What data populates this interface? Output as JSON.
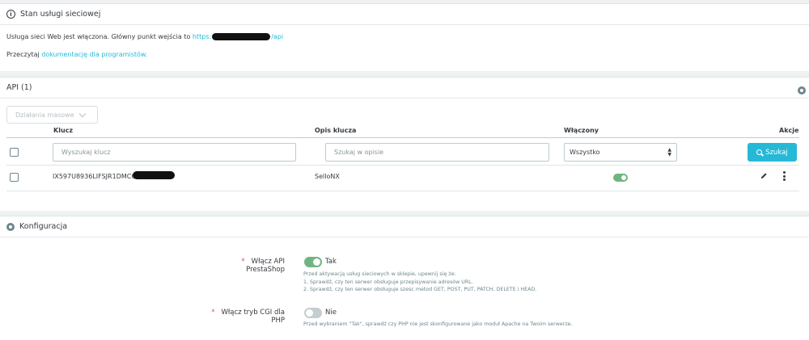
{
  "service_panel": {
    "title": "Stan usługi sieciowej",
    "status_text": "Usługa sieci Web jest włączona. Główny punkt wejścia to",
    "url_prefix": "https:",
    "url_suffix": "/api",
    "read_text": "Przeczytaj",
    "docs_link": "dokumentację dla programistów."
  },
  "api_panel": {
    "title": "API (1)",
    "bulk_actions": "Działania masowe",
    "columns": {
      "key": "Klucz",
      "description": "Opis klucza",
      "enabled": "Włączony",
      "actions": "Akcje"
    },
    "filters": {
      "key_placeholder": "Wyszukaj klucz",
      "desc_placeholder": "Szukaj w opisie",
      "enabled_select": "Wszystko",
      "search_button": "Szukaj"
    },
    "rows": [
      {
        "key": "IX597U8936LIFSJR1DMCCSA",
        "description": "SelloNX",
        "enabled": true
      }
    ]
  },
  "config_panel": {
    "title": "Konfiguracja",
    "enable_api_label": "Włącz API PrestaShop",
    "enable_api_value": "Tak",
    "enable_api_help": [
      "Przed aktywacją usług sieciowych w sklepie, upewnij się że:",
      "1. Sprawdź, czy ten serwer obsługuje przepisywanie adresów URL.",
      "2. Sprawdź, czy ten serwer obsługuje szesc metod GET, POST, PUT, PATCH, DELETE i HEAD."
    ],
    "cgi_label": "Włącz tryb CGI dla PHP",
    "cgi_value": "Nie",
    "cgi_help": "Przed wybraniem \"Tak\", sprawdź czy PHP nie jest skonfigurowane jako moduł Apache na Twoim serwerze.",
    "required_mark": "*"
  },
  "colors": {
    "accent": "#25b9d7",
    "toggle_on": "#70b580",
    "toggle_off": "#c5cdd0",
    "required": "#c05c67"
  }
}
